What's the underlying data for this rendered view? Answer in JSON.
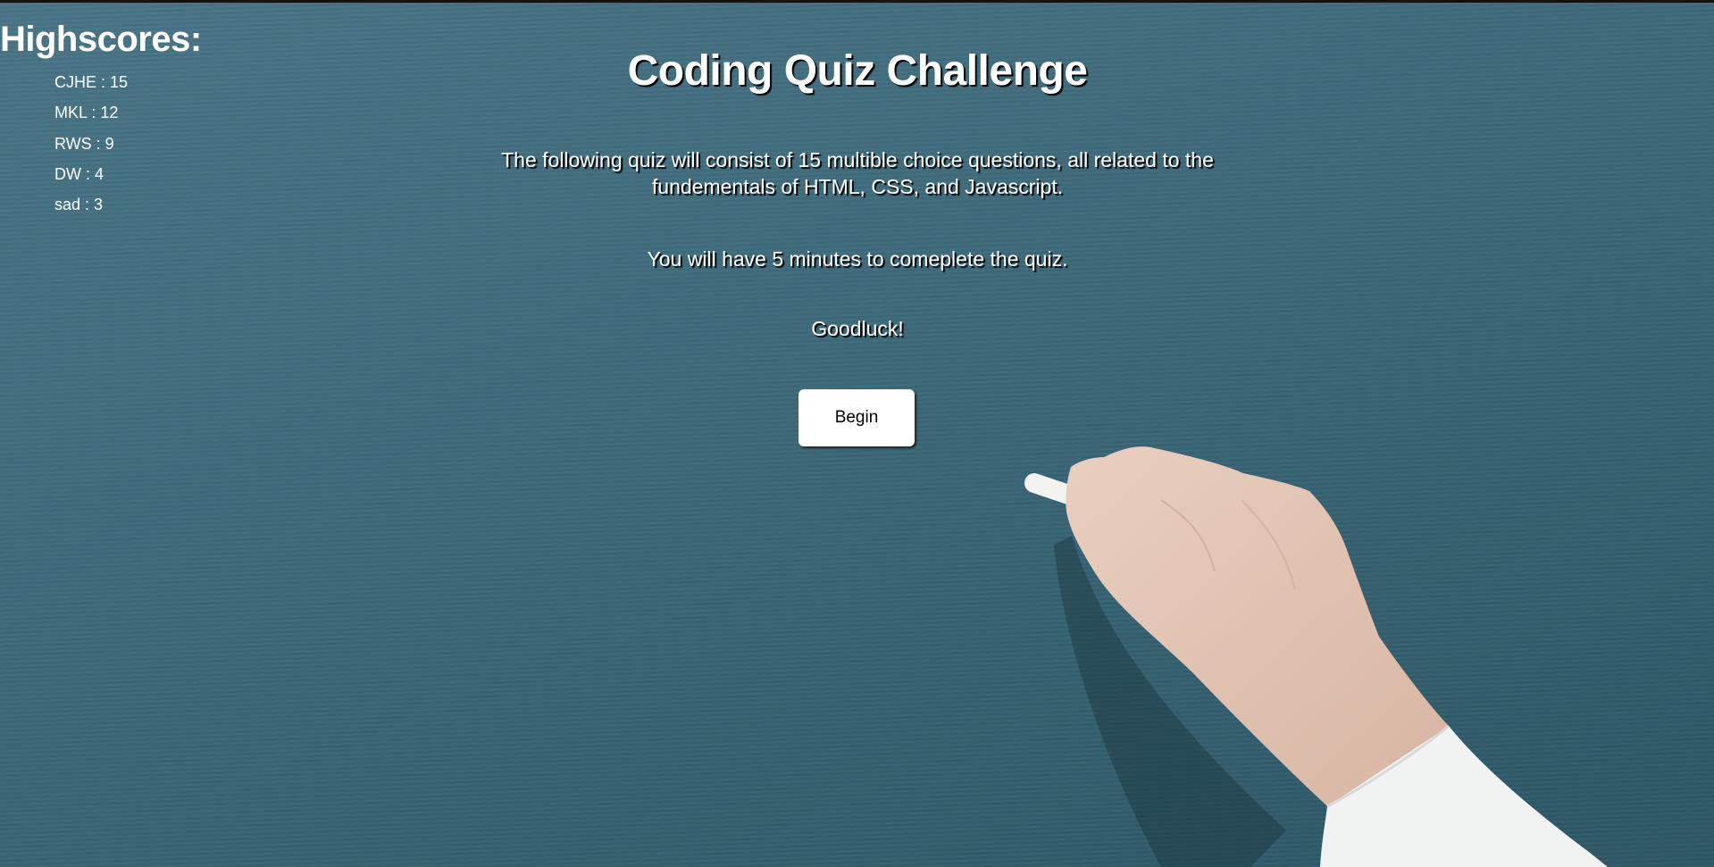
{
  "highscores": {
    "title": "Highscores:",
    "entries": [
      {
        "text": "CJHE : 15"
      },
      {
        "text": "MKL : 12"
      },
      {
        "text": "RWS : 9"
      },
      {
        "text": "DW : 4"
      },
      {
        "text": "sad : 3"
      }
    ]
  },
  "quiz": {
    "title": "Coding Quiz Challenge",
    "intro_line1": "The following quiz will consist of 15 multible choice questions, all related to the",
    "intro_line2": "fundementals of HTML, CSS, and Javascript.",
    "time_notice": "You will have 5 minutes to comeplete the quiz.",
    "goodluck": "Goodluck!",
    "begin_label": "Begin"
  },
  "background": {
    "image": "chalkboard-hand-with-chalk",
    "board_color": "#3f6b7c"
  }
}
